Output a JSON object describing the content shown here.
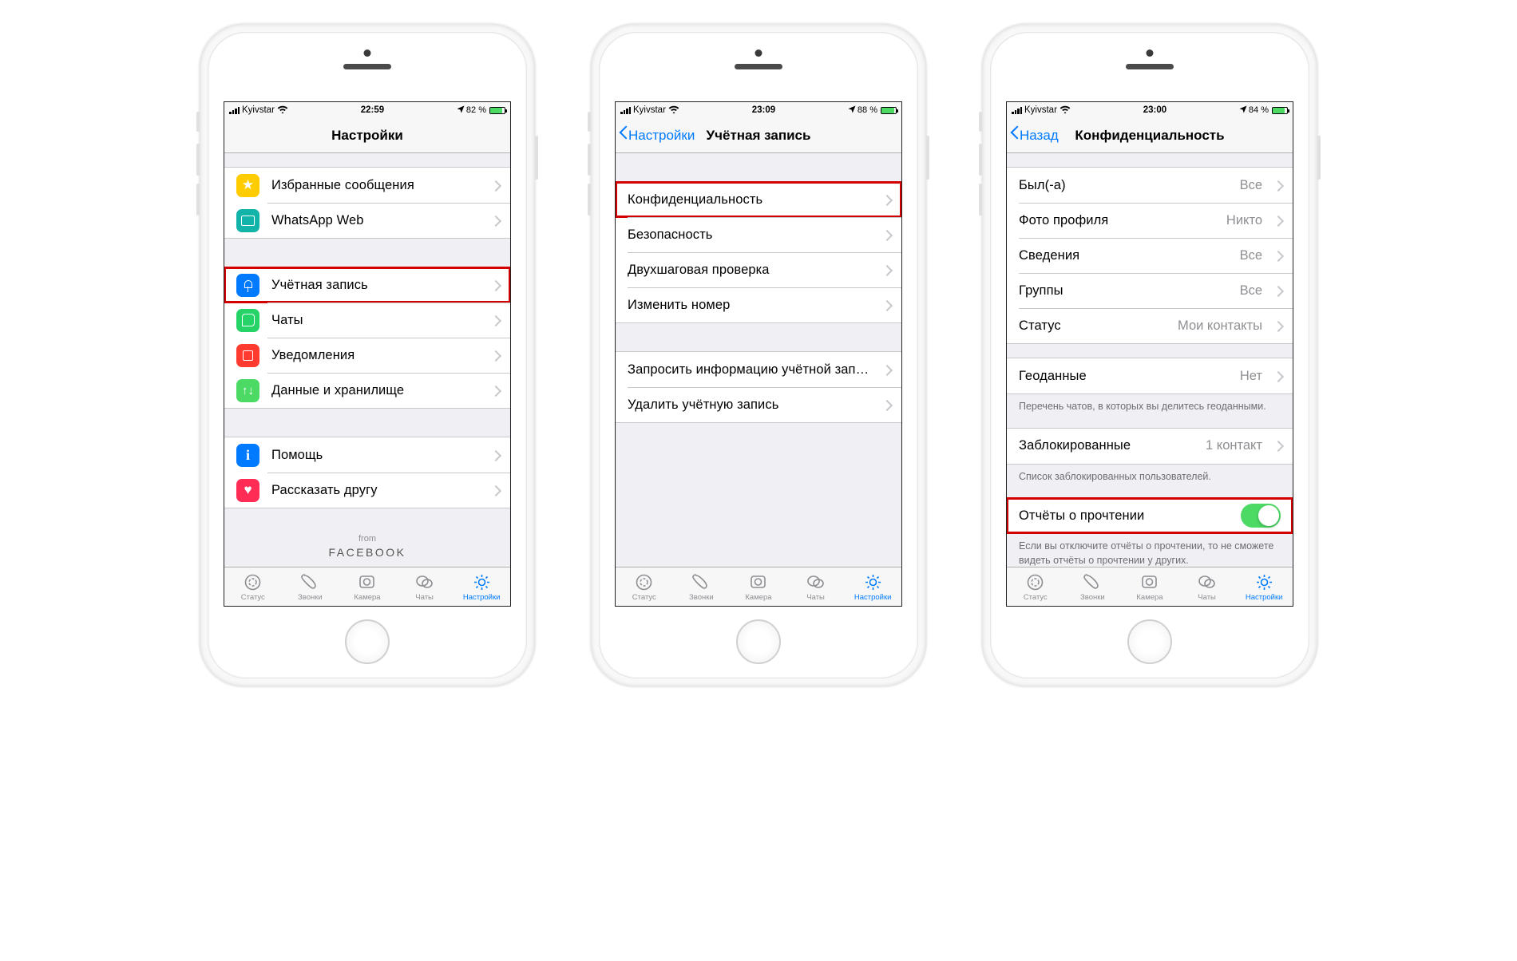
{
  "p1": {
    "status": {
      "carrier": "Kyivstar",
      "time": "22:59",
      "batt": "82 %",
      "batt_fill": 82
    },
    "title": "Настройки",
    "g1": [
      {
        "label": "Избранные сообщения",
        "ic": "ic-star"
      },
      {
        "label": "WhatsApp Web",
        "ic": "ic-web"
      }
    ],
    "g2": [
      {
        "label": "Учётная запись",
        "ic": "ic-key",
        "hl": true
      },
      {
        "label": "Чаты",
        "ic": "ic-chat"
      },
      {
        "label": "Уведомления",
        "ic": "ic-bell"
      },
      {
        "label": "Данные и хранилище",
        "ic": "ic-data"
      }
    ],
    "g3": [
      {
        "label": "Помощь",
        "ic": "ic-info"
      },
      {
        "label": "Рассказать другу",
        "ic": "ic-heart"
      }
    ],
    "from": "from",
    "fb": "FACEBOOK"
  },
  "p2": {
    "status": {
      "carrier": "Kyivstar",
      "time": "23:09",
      "batt": "88 %",
      "batt_fill": 88
    },
    "back": "Настройки",
    "title": "Учётная запись",
    "g1": [
      {
        "label": "Конфиденциальность",
        "hl": true
      },
      {
        "label": "Безопасность"
      },
      {
        "label": "Двухшаговая проверка"
      },
      {
        "label": "Изменить номер"
      }
    ],
    "g2": [
      {
        "label": "Запросить информацию учётной записи"
      },
      {
        "label": "Удалить учётную запись"
      }
    ]
  },
  "p3": {
    "status": {
      "carrier": "Kyivstar",
      "time": "23:00",
      "batt": "84 %",
      "batt_fill": 84
    },
    "back": "Назад",
    "title": "Конфиденциальность",
    "g1": [
      {
        "label": "Был(-а)",
        "val": "Все"
      },
      {
        "label": "Фото профиля",
        "val": "Никто"
      },
      {
        "label": "Сведения",
        "val": "Все"
      },
      {
        "label": "Группы",
        "val": "Все"
      },
      {
        "label": "Статус",
        "val": "Мои контакты"
      }
    ],
    "g2": [
      {
        "label": "Геоданные",
        "val": "Нет"
      }
    ],
    "g2_note": "Перечень чатов, в которых вы делитесь геоданными.",
    "g3": [
      {
        "label": "Заблокированные",
        "val": "1 контакт"
      }
    ],
    "g3_note": "Список заблокированных пользователей.",
    "g4": [
      {
        "label": "Отчёты о прочтении",
        "toggle": true,
        "hl": true
      }
    ],
    "g4_note": "Если вы отключите отчёты о прочтении, то не сможете видеть отчёты о прочтении у других."
  },
  "tabs": [
    {
      "label": "Статус"
    },
    {
      "label": "Звонки"
    },
    {
      "label": "Камера"
    },
    {
      "label": "Чаты"
    },
    {
      "label": "Настройки",
      "active": true
    }
  ]
}
